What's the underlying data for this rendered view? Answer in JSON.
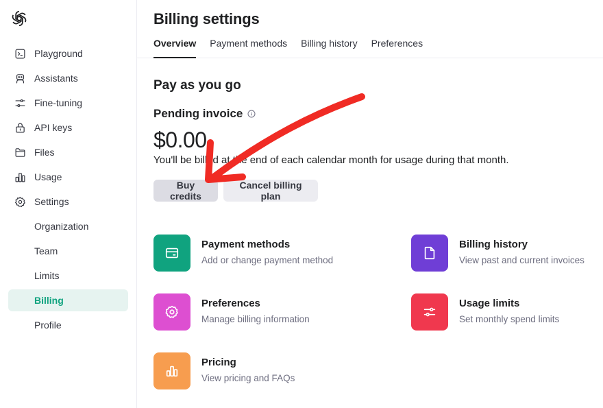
{
  "sidebar": {
    "items": [
      {
        "label": "Playground",
        "icon": "terminal-icon"
      },
      {
        "label": "Assistants",
        "icon": "robot-icon"
      },
      {
        "label": "Fine-tuning",
        "icon": "sliders-icon"
      },
      {
        "label": "API keys",
        "icon": "lock-icon"
      },
      {
        "label": "Files",
        "icon": "folder-icon"
      },
      {
        "label": "Usage",
        "icon": "bar-chart-icon"
      },
      {
        "label": "Settings",
        "icon": "gear-icon"
      }
    ],
    "sub_items": [
      "Organization",
      "Team",
      "Limits",
      "Billing",
      "Profile"
    ],
    "active": "Billing"
  },
  "header": {
    "title": "Billing settings",
    "tabs": [
      "Overview",
      "Payment methods",
      "Billing history",
      "Preferences"
    ],
    "active_tab": "Overview"
  },
  "main": {
    "section_title": "Pay as you go",
    "pending_label": "Pending invoice",
    "amount": "$0.00",
    "description": "You'll be billed at the end of each calendar month for usage during that month.",
    "buy_credits": "Buy credits",
    "cancel_plan": "Cancel billing plan",
    "cards": [
      {
        "title": "Payment methods",
        "subtitle": "Add or change payment method",
        "icon": "credit-card-icon",
        "color": "#10a37f"
      },
      {
        "title": "Billing history",
        "subtitle": "View past and current invoices",
        "icon": "document-icon",
        "color": "#6f3ed6"
      },
      {
        "title": "Preferences",
        "subtitle": "Manage billing information",
        "icon": "gear-icon",
        "color": "#dd4fd1"
      },
      {
        "title": "Usage limits",
        "subtitle": "Set monthly spend limits",
        "icon": "sliders-icon",
        "color": "#f0384e"
      },
      {
        "title": "Pricing",
        "subtitle": "View pricing and FAQs",
        "icon": "bar-chart-icon",
        "color": "#f79d4f"
      }
    ]
  },
  "annotation": {
    "color": "#f02b24"
  }
}
